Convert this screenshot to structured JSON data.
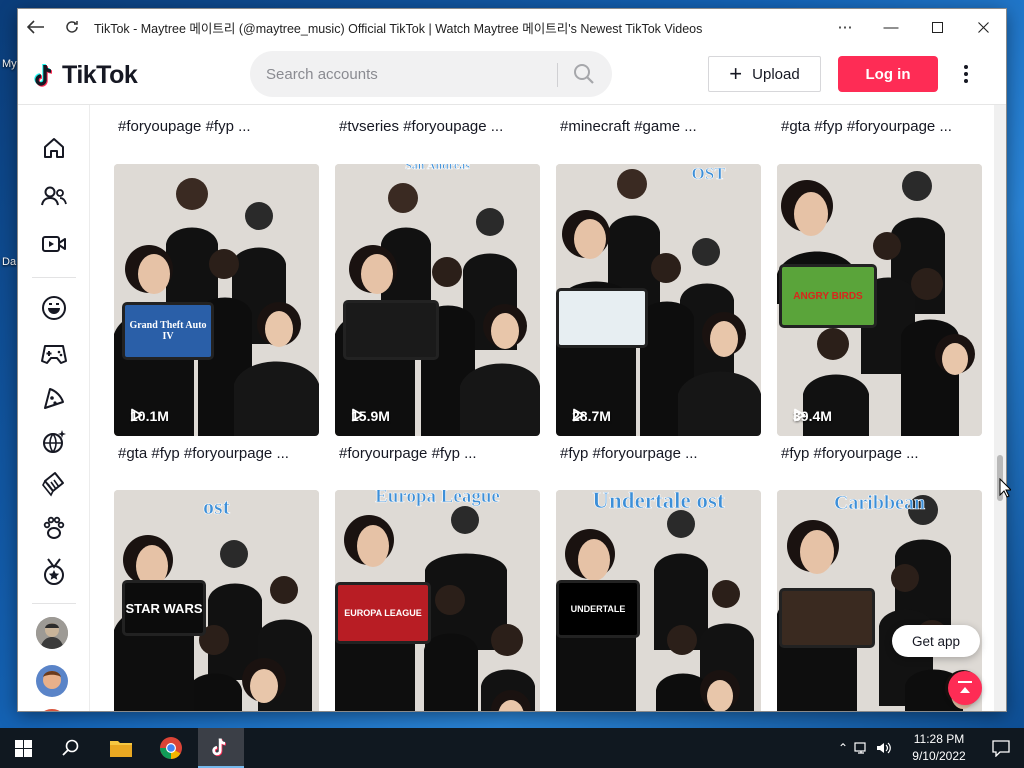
{
  "desktop": {
    "labels": [
      "My",
      "",
      "Da"
    ]
  },
  "window": {
    "title": "TikTok - Maytree 메이트리 (@maytree_music) Official TikTok | Watch Maytree 메이트리's Newest TikTok Videos"
  },
  "header": {
    "logo_text": "TikTok",
    "search_placeholder": "Search accounts",
    "upload_label": "Upload",
    "login_label": "Log in"
  },
  "top_captions": [
    "#foryoupage #fyp ...",
    "#tvseries #foryoupage ...",
    "#minecraft #game ...",
    "#gta #fyp #foryourpage ..."
  ],
  "videos_row1": [
    {
      "views": "10.1M",
      "caption": "#gta #fyp #foryourpage ...",
      "overlay": "",
      "tablet_text": "Grand Theft Auto IV",
      "tablet_color": "#2a5fa8"
    },
    {
      "views": "15.9M",
      "caption": "#foryourpage #fyp ...",
      "overlay": "San Andreas",
      "tablet_text": "",
      "tablet_color": "#1a1a1a"
    },
    {
      "views": "28.7M",
      "caption": "#fyp #foryourpage ...",
      "overlay": "OST",
      "tablet_text": "",
      "tablet_color": "#e7eef2"
    },
    {
      "views": "39.4M",
      "caption": "#fyp #foryourpage ...",
      "overlay": "",
      "tablet_text": "ANGRY BIRDS",
      "tablet_color": "#5aa43a"
    }
  ],
  "videos_row2": [
    {
      "overlay": "ost",
      "tablet_text": "STAR WARS",
      "tablet_color": "#0c0c0c"
    },
    {
      "overlay": "Europa League",
      "tablet_text": "EUROPA LEAGUE",
      "tablet_color": "#b81d24"
    },
    {
      "overlay": "Undertale ost",
      "tablet_text": "UNDERTALE",
      "tablet_color": "#000000"
    },
    {
      "overlay": "Caribbean",
      "tablet_text": "",
      "tablet_color": "#3a2a20"
    }
  ],
  "floating": {
    "get_app_label": "Get app"
  },
  "taskbar": {
    "time": "11:28 PM",
    "date": "9/10/2022"
  },
  "colors": {
    "brand_red": "#fe2c55",
    "brand_cyan": "#25f4ee",
    "text_dark": "#161823"
  }
}
